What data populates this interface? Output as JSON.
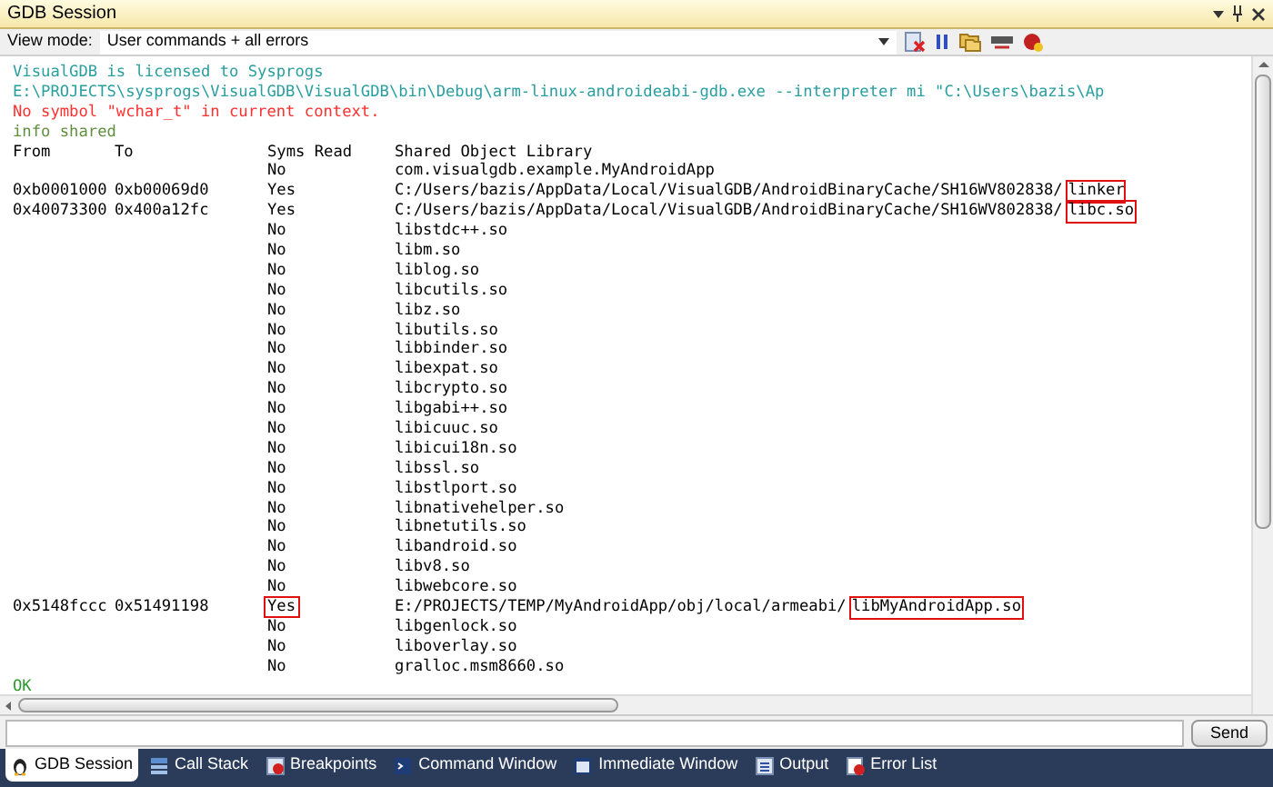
{
  "window": {
    "title": "GDB Session"
  },
  "toolbar": {
    "view_mode_label": "View mode:",
    "view_mode_value": "User commands + all errors"
  },
  "console": {
    "lines": [
      {
        "kind": "info",
        "text": "VisualGDB is licensed to Sysprogs"
      },
      {
        "kind": "info",
        "text": "E:\\PROJECTS\\sysprogs\\VisualGDB\\VisualGDB\\bin\\Debug\\arm-linux-androideabi-gdb.exe --interpreter mi \"C:\\Users\\bazis\\Ap"
      },
      {
        "kind": "error",
        "text": "No symbol \"wchar_t\" in current context."
      },
      {
        "kind": "echo",
        "text": "info shared"
      },
      {
        "kind": "table_header",
        "from": "From",
        "to": "To",
        "syms_read": "Syms Read",
        "library": "Shared Object Library"
      },
      {
        "kind": "table_row",
        "syms_read": "No",
        "library": "com.visualgdb.example.MyAndroidApp"
      },
      {
        "kind": "table_row",
        "from": "0xb0001000",
        "to": "0xb00069d0",
        "syms_read": "Yes",
        "library": "C:/Users/bazis/AppData/Local/VisualGDB/AndroidBinaryCache/SH16WV802838/",
        "library_file": "linker",
        "file_highlighted": true
      },
      {
        "kind": "table_row",
        "from": "0x40073300",
        "to": "0x400a12fc",
        "syms_read": "Yes",
        "library": "C:/Users/bazis/AppData/Local/VisualGDB/AndroidBinaryCache/SH16WV802838/",
        "library_file": "libc.so",
        "file_highlighted": true
      },
      {
        "kind": "table_row",
        "syms_read": "No",
        "library": "libstdc++.so"
      },
      {
        "kind": "table_row",
        "syms_read": "No",
        "library": "libm.so"
      },
      {
        "kind": "table_row",
        "syms_read": "No",
        "library": "liblog.so"
      },
      {
        "kind": "table_row",
        "syms_read": "No",
        "library": "libcutils.so"
      },
      {
        "kind": "table_row",
        "syms_read": "No",
        "library": "libz.so"
      },
      {
        "kind": "table_row",
        "syms_read": "No",
        "library": "libutils.so"
      },
      {
        "kind": "table_row",
        "syms_read": "No",
        "library": "libbinder.so"
      },
      {
        "kind": "table_row",
        "syms_read": "No",
        "library": "libexpat.so"
      },
      {
        "kind": "table_row",
        "syms_read": "No",
        "library": "libcrypto.so"
      },
      {
        "kind": "table_row",
        "syms_read": "No",
        "library": "libgabi++.so"
      },
      {
        "kind": "table_row",
        "syms_read": "No",
        "library": "libicuuc.so"
      },
      {
        "kind": "table_row",
        "syms_read": "No",
        "library": "libicui18n.so"
      },
      {
        "kind": "table_row",
        "syms_read": "No",
        "library": "libssl.so"
      },
      {
        "kind": "table_row",
        "syms_read": "No",
        "library": "libstlport.so"
      },
      {
        "kind": "table_row",
        "syms_read": "No",
        "library": "libnativehelper.so"
      },
      {
        "kind": "table_row",
        "syms_read": "No",
        "library": "libnetutils.so"
      },
      {
        "kind": "table_row",
        "syms_read": "No",
        "library": "libandroid.so"
      },
      {
        "kind": "table_row",
        "syms_read": "No",
        "library": "libv8.so"
      },
      {
        "kind": "table_row",
        "syms_read": "No",
        "library": "libwebcore.so"
      },
      {
        "kind": "table_row",
        "from": "0x5148fccc",
        "to": "0x51491198",
        "syms_read": "Yes",
        "syms_highlighted": true,
        "library": "E:/PROJECTS/TEMP/MyAndroidApp/obj/local/armeabi/",
        "library_file": "libMyAndroidApp.so",
        "file_highlighted": true
      },
      {
        "kind": "table_row",
        "syms_read": "No",
        "library": "libgenlock.so"
      },
      {
        "kind": "table_row",
        "syms_read": "No",
        "library": "liboverlay.so"
      },
      {
        "kind": "table_row",
        "syms_read": "No",
        "library": "gralloc.msm8660.so"
      },
      {
        "kind": "result",
        "text": "OK"
      }
    ]
  },
  "input": {
    "send_button": "Send"
  },
  "tabs": [
    {
      "label": "GDB Session",
      "selected": true
    },
    {
      "label": "Call Stack",
      "selected": false
    },
    {
      "label": "Breakpoints",
      "selected": false
    },
    {
      "label": "Command Window",
      "selected": false
    },
    {
      "label": "Immediate Window",
      "selected": false
    },
    {
      "label": "Output",
      "selected": false
    },
    {
      "label": "Error List",
      "selected": false
    }
  ]
}
